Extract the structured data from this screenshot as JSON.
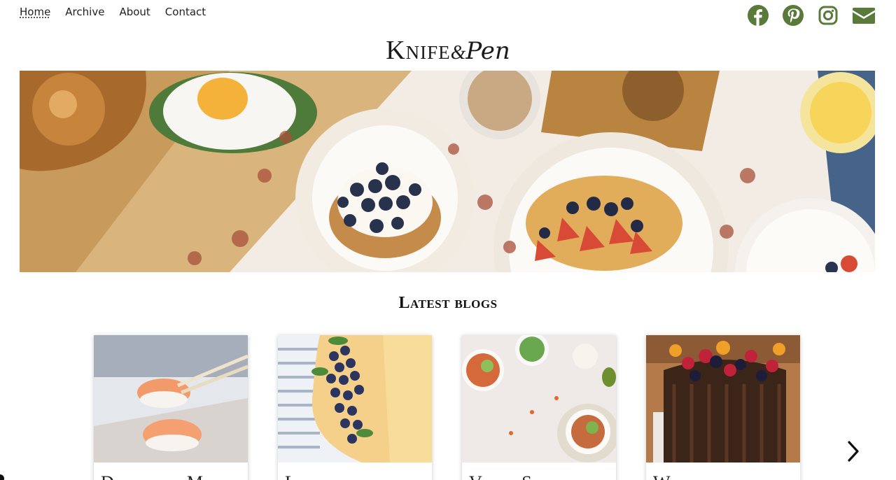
{
  "nav": {
    "items": [
      {
        "label": "Home",
        "active": true
      },
      {
        "label": "Archive",
        "active": false
      },
      {
        "label": "About",
        "active": false
      },
      {
        "label": "Contact",
        "active": false
      }
    ]
  },
  "social": {
    "icons": [
      "facebook-icon",
      "pinterest-icon",
      "instagram-icon",
      "mail-icon"
    ],
    "color": "#5a7a3a"
  },
  "logo": {
    "part1": "Knife",
    "part2": "&",
    "part3": "Pen"
  },
  "section": {
    "title": "Latest blogs"
  },
  "cards": [
    {
      "title": "Date-night Make"
    },
    {
      "title": "Lemon and"
    },
    {
      "title": "Vegan Super"
    },
    {
      "title": "Worlds best"
    }
  ],
  "carousel": {
    "next_icon": "chevron-right-icon"
  }
}
